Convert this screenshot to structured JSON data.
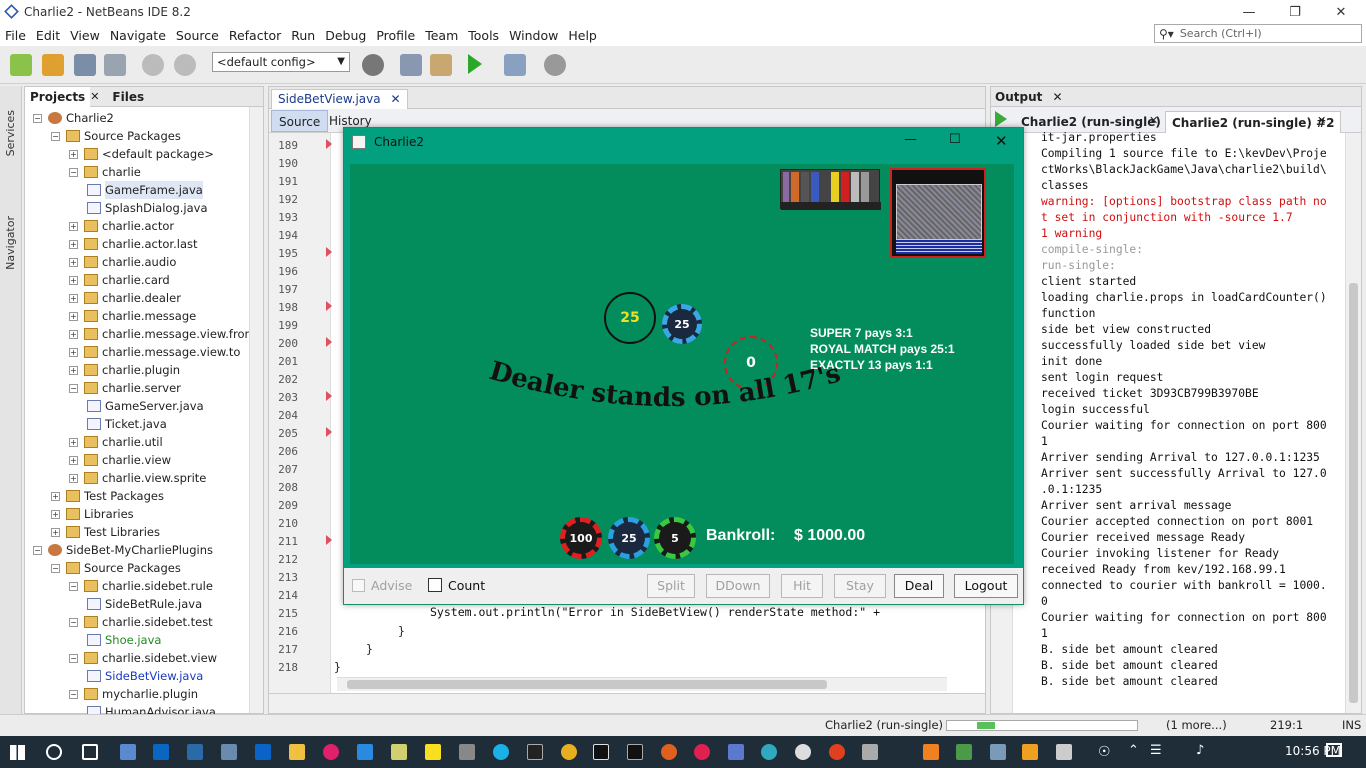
{
  "window": {
    "title": "Charlie2 - NetBeans IDE 8.2"
  },
  "menu": [
    "File",
    "Edit",
    "View",
    "Navigate",
    "Source",
    "Refactor",
    "Run",
    "Debug",
    "Profile",
    "Team",
    "Tools",
    "Window",
    "Help"
  ],
  "search": {
    "placeholder": "Search (Ctrl+I)"
  },
  "toolbar": {
    "config": "<default config>"
  },
  "left_strip": {
    "services": "Services",
    "navigator": "Navigator"
  },
  "projects": {
    "tabs": [
      "Projects",
      "Files"
    ],
    "tree": [
      "Charlie2",
      "Source Packages",
      "<default package>",
      "charlie",
      "GameFrame.java",
      "SplashDialog.java",
      "charlie.actor",
      "charlie.actor.last",
      "charlie.audio",
      "charlie.card",
      "charlie.dealer",
      "charlie.message",
      "charlie.message.view.from",
      "charlie.message.view.to",
      "charlie.plugin",
      "charlie.server",
      "GameServer.java",
      "Ticket.java",
      "charlie.util",
      "charlie.view",
      "charlie.view.sprite",
      "Test Packages",
      "Libraries",
      "Test Libraries",
      "SideBet-MyCharliePlugins",
      "Source Packages",
      "charlie.sidebet.rule",
      "SideBetRule.java",
      "charlie.sidebet.test",
      "Shoe.java",
      "charlie.sidebet.view",
      "SideBetView.java",
      "mycharlie.plugin",
      "HumanAdvisor.java"
    ]
  },
  "editor": {
    "tab": "SideBetView.java",
    "source_label": "Source",
    "history_label": "History",
    "lines": [
      "189",
      "190",
      "191",
      "192",
      "193",
      "194",
      "195",
      "196",
      "197",
      "198",
      "199",
      "200",
      "201",
      "202",
      "203",
      "204",
      "205",
      "206",
      "207",
      "208",
      "209",
      "210",
      "211",
      "212",
      "213",
      "214",
      "215",
      "216",
      "217",
      "218"
    ],
    "code_215": "System.out.println(\"Error in SideBetView() renderState method:\" +",
    "code_216": "}",
    "code_217": "}",
    "code_218": "}"
  },
  "game": {
    "title": "Charlie2",
    "bet_circle_value": "25",
    "bet_chip": "25",
    "side_bet_value": "0",
    "payouts": [
      "SUPER 7 pays 3:1",
      "ROYAL MATCH pays 25:1",
      "EXACTLY 13 pays 1:1"
    ],
    "banner": "Dealer stands on all 17's",
    "chips": [
      "100",
      "25",
      "5"
    ],
    "bankroll_label": "Bankroll:",
    "bankroll_value": "$ 1000.00",
    "advise_label": "Advise",
    "count_label": "Count",
    "buttons": [
      "Split",
      "DDown",
      "Hit",
      "Stay",
      "Deal",
      "Logout"
    ],
    "colors": {
      "felt": "#038c5c",
      "frame": "#02a07e"
    }
  },
  "output": {
    "title": "Output",
    "tabs": [
      "Charlie2 (run-single)",
      "Charlie2 (run-single) #2"
    ],
    "lines": [
      {
        "t": "it-jar.properties",
        "c": ""
      },
      {
        "t": "Compiling 1 source file to E:\\kevDev\\Proje",
        "c": ""
      },
      {
        "t": "ctWorks\\BlackJackGame\\Java\\charlie2\\build\\",
        "c": ""
      },
      {
        "t": "classes",
        "c": ""
      },
      {
        "t": "warning: [options] bootstrap class path no",
        "c": "red"
      },
      {
        "t": "t set in conjunction with -source 1.7",
        "c": "red"
      },
      {
        "t": "1 warning",
        "c": "red"
      },
      {
        "t": "compile-single:",
        "c": "gray"
      },
      {
        "t": "run-single:",
        "c": "gray"
      },
      {
        "t": "client started",
        "c": ""
      },
      {
        "t": "loading charlie.props in loadCardCounter()",
        "c": ""
      },
      {
        "t": " function",
        "c": ""
      },
      {
        "t": "side bet view constructed",
        "c": ""
      },
      {
        "t": "successfully loaded side bet view",
        "c": ""
      },
      {
        "t": "init done",
        "c": ""
      },
      {
        "t": "sent login request",
        "c": ""
      },
      {
        "t": "received ticket 3D93CB799B3970BE",
        "c": ""
      },
      {
        "t": "login successful",
        "c": ""
      },
      {
        "t": "Courier waiting for connection on port 800",
        "c": ""
      },
      {
        "t": "1",
        "c": ""
      },
      {
        "t": "Arriver sending Arrival to 127.0.0.1:1235",
        "c": ""
      },
      {
        "t": "Arriver sent successfully Arrival to 127.0",
        "c": ""
      },
      {
        "t": ".0.1:1235",
        "c": ""
      },
      {
        "t": "Arriver sent arrival message",
        "c": ""
      },
      {
        "t": "Courier accepted connection on port 8001",
        "c": ""
      },
      {
        "t": "Courier received message Ready",
        "c": ""
      },
      {
        "t": "Courier invoking listener for Ready",
        "c": ""
      },
      {
        "t": "received Ready from kev/192.168.99.1",
        "c": ""
      },
      {
        "t": "connected to courier with bankroll = 1000.",
        "c": ""
      },
      {
        "t": "0",
        "c": ""
      },
      {
        "t": "Courier waiting for connection on port 800",
        "c": ""
      },
      {
        "t": "1",
        "c": ""
      },
      {
        "t": "B. side bet amount cleared",
        "c": ""
      },
      {
        "t": "B. side bet amount cleared",
        "c": ""
      },
      {
        "t": "B. side bet amount cleared",
        "c": ""
      }
    ]
  },
  "status": {
    "task": "Charlie2 (run-single) #2",
    "more": "(1 more...)",
    "pos": "219:1",
    "mode": "INS"
  },
  "taskbar": {
    "time": "10:56 PM"
  }
}
